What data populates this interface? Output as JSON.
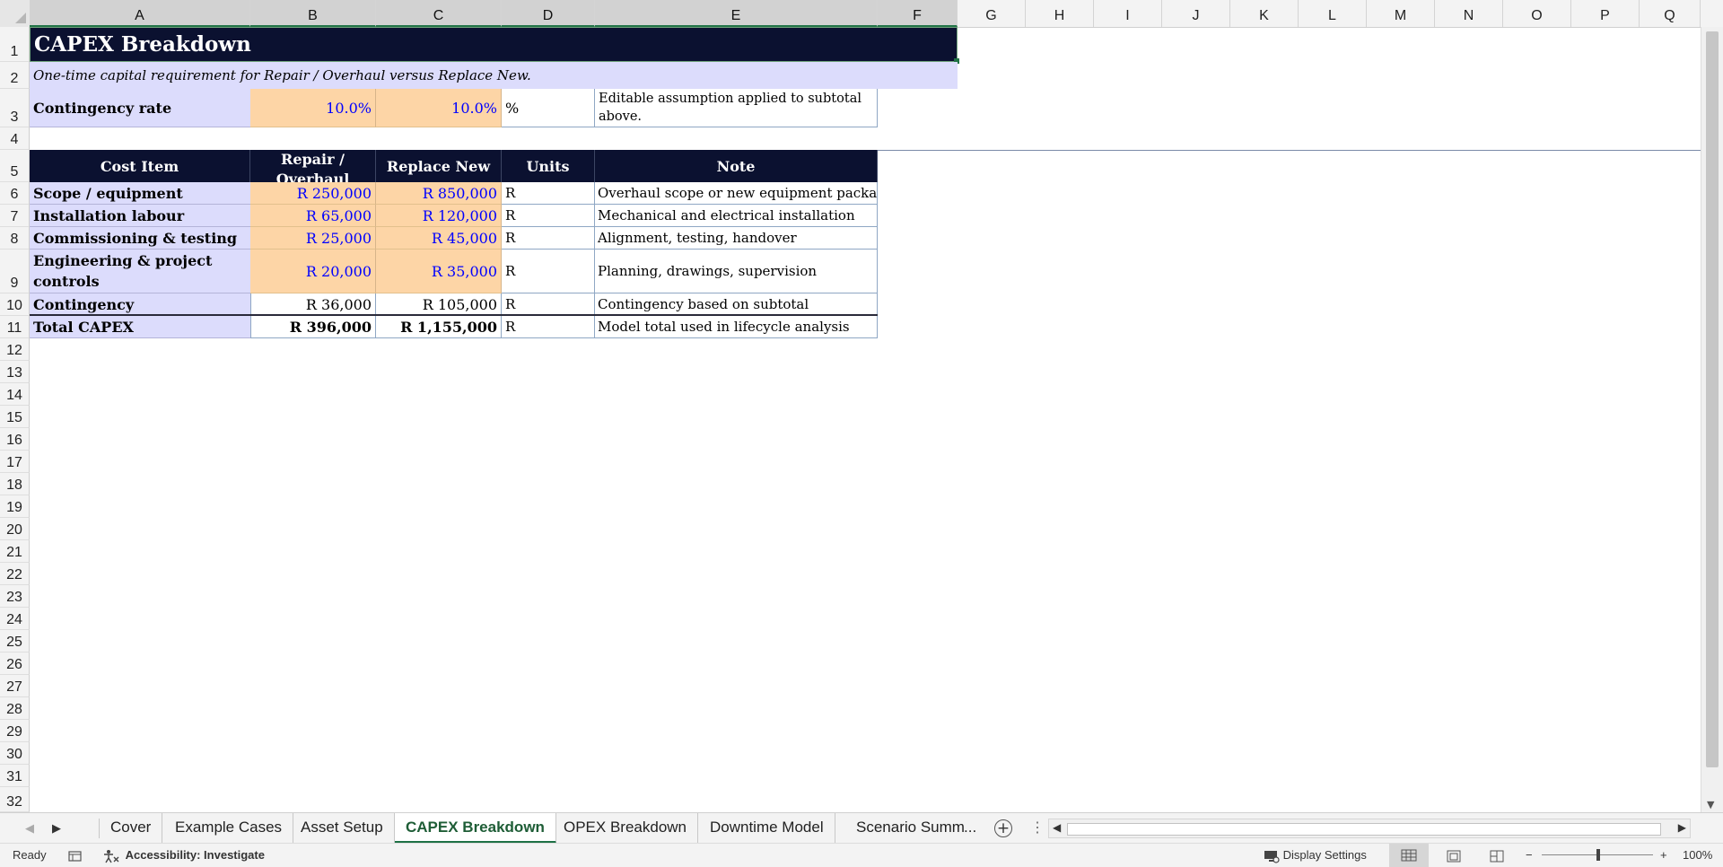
{
  "columns": [
    "A",
    "B",
    "C",
    "D",
    "E",
    "F",
    "G",
    "H",
    "I",
    "J",
    "K",
    "L",
    "M",
    "N",
    "O",
    "P",
    "Q"
  ],
  "rows": [
    "1",
    "2",
    "3",
    "4",
    "5",
    "6",
    "7",
    "8",
    "9",
    "10",
    "11",
    "12",
    "13",
    "14",
    "15",
    "16",
    "17",
    "18",
    "19",
    "20",
    "21",
    "22",
    "23",
    "24",
    "25",
    "26",
    "27",
    "28",
    "29",
    "30",
    "31",
    "32"
  ],
  "sheet": {
    "title": "CAPEX Breakdown",
    "subtitle": "One-time capital requirement for Repair / Overhaul versus Replace New.",
    "contingency": {
      "label": "Contingency rate",
      "repair": "10.0%",
      "replace": "10.0%",
      "unit": "%",
      "note": "Editable assumption applied to subtotal above."
    },
    "table_headers": [
      "Cost Item",
      "Repair / Overhaul",
      "Replace New",
      "Units",
      "Note"
    ],
    "table_rows": [
      {
        "item": "Scope / equipment",
        "repair": "R 250,000",
        "replace": "R 850,000",
        "units": "R",
        "note": "Overhaul scope or new equipment package"
      },
      {
        "item": "Installation labour",
        "repair": "R 65,000",
        "replace": "R 120,000",
        "units": "R",
        "note": "Mechanical and electrical installation"
      },
      {
        "item": "Commissioning & testing",
        "repair": "R 25,000",
        "replace": "R 45,000",
        "units": "R",
        "note": "Alignment, testing, handover"
      },
      {
        "item": "Engineering & project controls",
        "repair": "R 20,000",
        "replace": "R 35,000",
        "units": "R",
        "note": "Planning, drawings, supervision"
      },
      {
        "item": "Contingency",
        "repair": "R 36,000",
        "replace": "R 105,000",
        "units": "R",
        "note": "Contingency based on subtotal"
      },
      {
        "item": "Total CAPEX",
        "repair": "R 396,000",
        "replace": "R 1,155,000",
        "units": "R",
        "note": "Model total used in lifecycle analysis"
      }
    ]
  },
  "tabs": [
    "Cover",
    "Example Cases",
    "Asset Setup",
    "CAPEX Breakdown",
    "OPEX Breakdown",
    "Downtime Model",
    "Scenario Summ",
    "..."
  ],
  "active_tab": "CAPEX Breakdown",
  "status": {
    "mode": "Ready",
    "accessibility": "Accessibility: Investigate",
    "display_settings": "Display Settings",
    "zoom": "100%"
  },
  "colors": {
    "header_dark": "#0b1130",
    "label_lavender": "#dcdcfc",
    "input_orange": "#fdd5a6",
    "input_text_blue": "#0000ff",
    "excel_green": "#217346"
  }
}
